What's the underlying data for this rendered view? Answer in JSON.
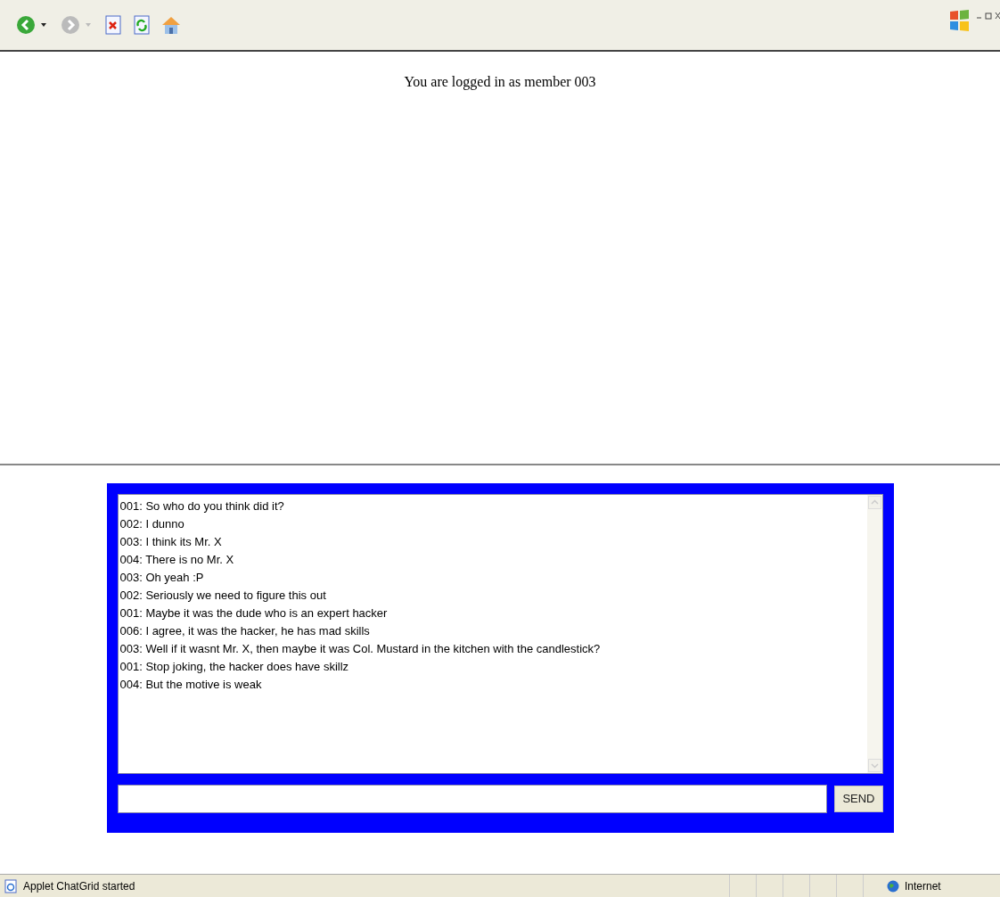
{
  "page": {
    "login_text": "You are logged in as member 003"
  },
  "chat": {
    "messages": [
      "001: So who do you think did it?",
      "002: I dunno",
      "003: I think its Mr. X",
      "004: There is no Mr. X",
      "003: Oh yeah :P",
      "002: Seriously we need to figure this out",
      "001: Maybe it was the dude who is an expert hacker",
      "006: I agree, it was the hacker, he has mad skills",
      "003: Well if it wasnt Mr. X, then maybe it was Col. Mustard in the kitchen with the candlestick?",
      "001: Stop joking, the hacker does have skillz",
      "004: But the motive is weak"
    ],
    "send_button": "SEND"
  },
  "status_bar": {
    "message": "Applet ChatGrid started",
    "zone": "Internet"
  }
}
